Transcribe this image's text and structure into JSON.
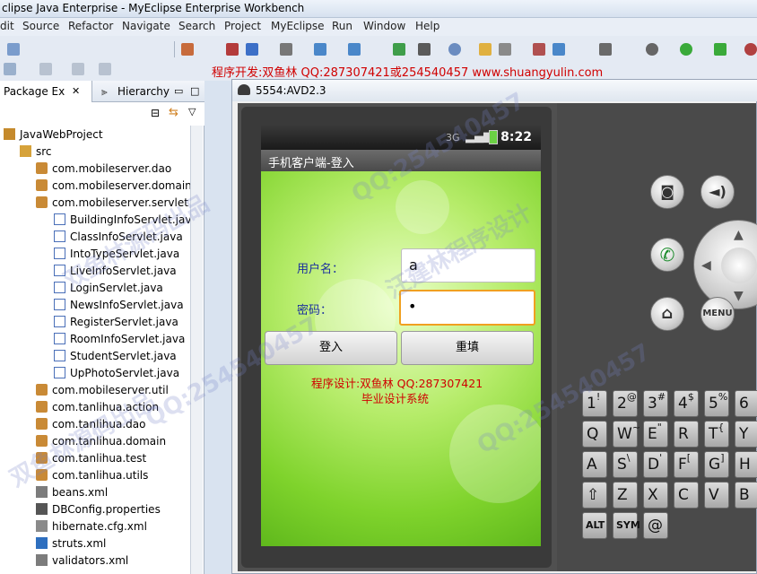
{
  "window": {
    "title": "clipse Java Enterprise - MyEclipse Enterprise Workbench"
  },
  "menu": [
    "dit",
    "Source",
    "Refactor",
    "Navigate",
    "Search",
    "Project",
    "MyEclipse",
    "Run",
    "Window",
    "Help"
  ],
  "credit_banner": "程序开发:双鱼林 QQ:287307421或254540457 www.shuangyulin.com",
  "left_panel": {
    "tabs": [
      "Package Ex",
      "Hierarchy"
    ],
    "tree": [
      {
        "label": "JavaWebProject",
        "level": 0,
        "icon": "project-icon"
      },
      {
        "label": "src",
        "level": 1,
        "icon": "source-folder-icon"
      },
      {
        "label": "com.mobileserver.dao",
        "level": 2,
        "icon": "package-icon"
      },
      {
        "label": "com.mobileserver.domain",
        "level": 2,
        "icon": "package-icon"
      },
      {
        "label": "com.mobileserver.servlet",
        "level": 2,
        "icon": "package-icon"
      },
      {
        "label": "BuildingInfoServlet.java",
        "level": 3,
        "icon": "java-file-icon"
      },
      {
        "label": "ClassInfoServlet.java",
        "level": 3,
        "icon": "java-file-icon"
      },
      {
        "label": "IntoTypeServlet.java",
        "level": 3,
        "icon": "java-file-icon"
      },
      {
        "label": "LiveInfoServlet.java",
        "level": 3,
        "icon": "java-file-icon"
      },
      {
        "label": "LoginServlet.java",
        "level": 3,
        "icon": "java-file-icon"
      },
      {
        "label": "NewsInfoServlet.java",
        "level": 3,
        "icon": "java-file-icon"
      },
      {
        "label": "RegisterServlet.java",
        "level": 3,
        "icon": "java-file-icon"
      },
      {
        "label": "RoomInfoServlet.java",
        "level": 3,
        "icon": "java-file-icon"
      },
      {
        "label": "StudentServlet.java",
        "level": 3,
        "icon": "java-file-icon"
      },
      {
        "label": "UpPhotoServlet.java",
        "level": 3,
        "icon": "java-file-icon"
      },
      {
        "label": "com.mobileserver.util",
        "level": 2,
        "icon": "package-icon"
      },
      {
        "label": "com.tanlihua.action",
        "level": 2,
        "icon": "package-icon"
      },
      {
        "label": "com.tanlihua.dao",
        "level": 2,
        "icon": "package-icon"
      },
      {
        "label": "com.tanlihua.domain",
        "level": 2,
        "icon": "package-icon"
      },
      {
        "label": "com.tanlihua.test",
        "level": 2,
        "icon": "package-icon"
      },
      {
        "label": "com.tanlihua.utils",
        "level": 2,
        "icon": "package-icon"
      },
      {
        "label": "beans.xml",
        "level": 2,
        "icon": "xml-file-icon"
      },
      {
        "label": "DBConfig.properties",
        "level": 2,
        "icon": "properties-file-icon"
      },
      {
        "label": "hibernate.cfg.xml",
        "level": 2,
        "icon": "hibernate-file-icon"
      },
      {
        "label": "struts.xml",
        "level": 2,
        "icon": "struts-file-icon"
      },
      {
        "label": "validators.xml",
        "level": 2,
        "icon": "xml-file-icon"
      }
    ]
  },
  "emulator": {
    "window_title": "5554:AVD2.3",
    "status_time": "8:22",
    "app_title": "手机客户端-登入",
    "username_label": "用户名：",
    "username_value": "a",
    "password_label": "密码：",
    "password_value": "•",
    "login_button": "登入",
    "reset_button": "重填",
    "designer_line": "程序设计:双鱼林  QQ:287307421",
    "system_line": "毕业设计系统",
    "menu_key": "MENU",
    "keyboard": {
      "row1": [
        [
          "1",
          "!"
        ],
        [
          "2",
          "@"
        ],
        [
          "3",
          "#"
        ],
        [
          "4",
          "$"
        ],
        [
          "5",
          "%"
        ],
        [
          "6",
          ""
        ]
      ],
      "row2": [
        [
          "Q",
          ""
        ],
        [
          "W",
          "~"
        ],
        [
          "E",
          "\""
        ],
        [
          "R",
          ""
        ],
        [
          "T",
          "{"
        ],
        [
          "Y",
          ""
        ]
      ],
      "row3": [
        [
          "A",
          ""
        ],
        [
          "S",
          "\\"
        ],
        [
          "D",
          "'"
        ],
        [
          "F",
          "["
        ],
        [
          "G",
          "]"
        ],
        [
          "H",
          ""
        ]
      ],
      "row4": [
        [
          "⇧",
          ""
        ],
        [
          "Z",
          ""
        ],
        [
          "X",
          ""
        ],
        [
          "C",
          ""
        ],
        [
          "V",
          ""
        ],
        [
          "B",
          ""
        ]
      ],
      "row5": [
        [
          "ALT",
          ""
        ],
        [
          "SYM",
          ""
        ],
        [
          "@",
          ""
        ]
      ]
    }
  },
  "watermarks": [
    "QQ:254540457",
    "汪建林程序设计",
    "双鱼林源码出品"
  ]
}
